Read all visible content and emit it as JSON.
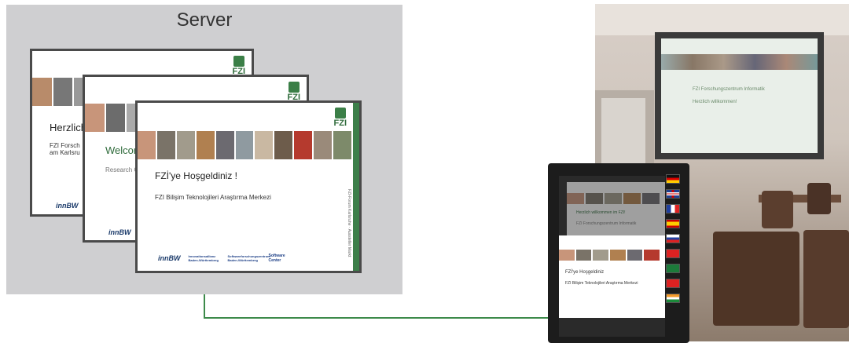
{
  "server": {
    "title": "Server"
  },
  "slides": {
    "back": {
      "logo": "FZI",
      "greeting": "Herzlich",
      "line1": "FZI Forsch",
      "line2": "am Karlsru",
      "footer_logo": "innBW"
    },
    "middle": {
      "logo": "FZI",
      "greeting": "Welcome",
      "line1": "Research C",
      "footer_logo": "innBW"
    },
    "front": {
      "logo": "FZI",
      "greeting": "FZİ'ye Hoşgeldiniz !",
      "line1": "FZI Bilişim Teknolojileri Araştırma Merkezi",
      "footer_logos": [
        "innBW",
        "Innovationsallianz Baden-Württemberg",
        "Softwareforschungszentrum Baden-Württemberg",
        "Software Center"
      ],
      "sidebar_text": "FZI-Forum Karlsruhe · Aussteller Markt"
    }
  },
  "projection": {
    "line1": "FZI Forschungszentrum Informatik",
    "line2": "Herzlich willkommen!"
  },
  "kiosk": {
    "top_slide_line1": "Herzlich willkommen im FZI!",
    "top_slide_line2": "FZI Forschungszentrum Informatik",
    "bottom_slide_line1": "FZİ'ye Hoşgeldiniz",
    "bottom_slide_line2": "FZI Bilişim Teknolojileri Araştırma Merkezi",
    "flags": [
      "germany",
      "united-kingdom",
      "france",
      "spain",
      "russia",
      "turkey",
      "saudi-arabia",
      "china",
      "india"
    ]
  },
  "colors": {
    "connection": "#3c8a4a",
    "server_bg": "#cfcfd1",
    "fzi_green": "#3d7f4a"
  }
}
